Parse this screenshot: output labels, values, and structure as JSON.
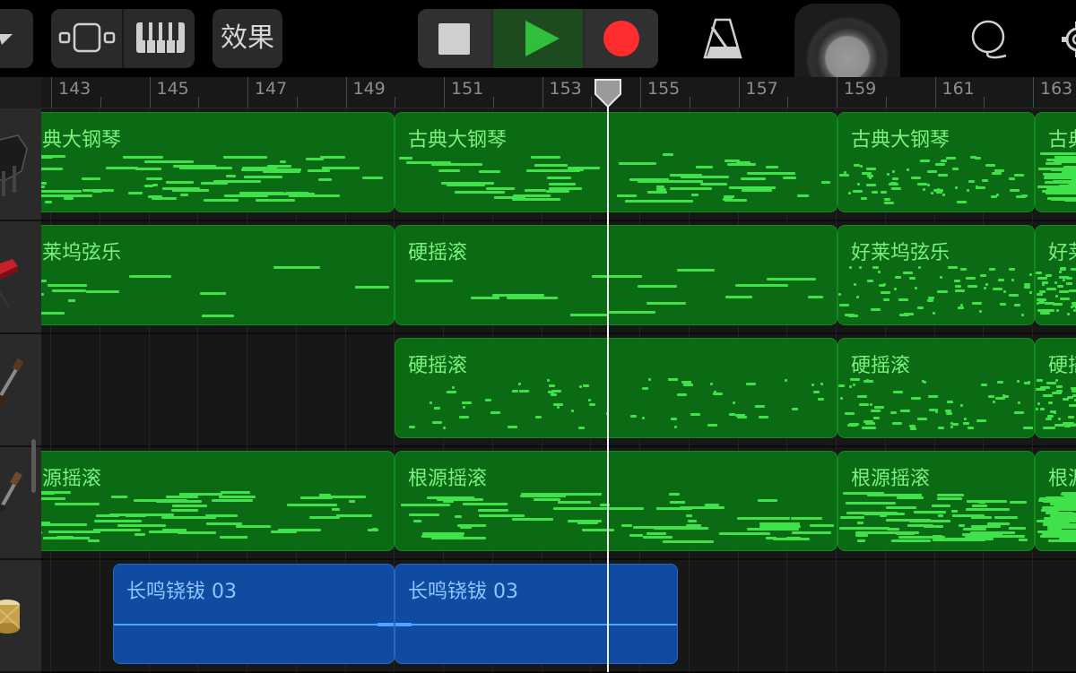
{
  "toolbar": {
    "effects_label": "效果"
  },
  "ruler": {
    "bar_numbers": [
      "143",
      "145",
      "147",
      "149",
      "151",
      "153",
      "155",
      "157",
      "159",
      "161",
      "163"
    ]
  },
  "tracks": [
    {
      "regions": [
        {
          "name": "典大钢琴"
        },
        {
          "name": "古典大钢琴"
        },
        {
          "name": "古典大钢琴"
        },
        {
          "name": "古典"
        }
      ]
    },
    {
      "regions": [
        {
          "name": "莱坞弦乐"
        },
        {
          "name": "硬摇滚"
        },
        {
          "name": "好莱坞弦乐"
        },
        {
          "name": "好莱"
        }
      ]
    },
    {
      "regions": [
        {
          "name": "硬摇滚"
        },
        {
          "name": "硬摇滚"
        },
        {
          "name": "硬摇"
        }
      ]
    },
    {
      "regions": [
        {
          "name": "源摇滚"
        },
        {
          "name": "根源摇滚"
        },
        {
          "name": "根源摇滚"
        },
        {
          "name": "根源"
        }
      ]
    },
    {
      "regions": [
        {
          "name": "长鸣铙钹 03"
        },
        {
          "name": "长鸣铙钹 03"
        }
      ]
    }
  ],
  "colors": {
    "midi_region": "#0a6b14",
    "midi_note": "#3fe24a",
    "audio_region": "#0f4ba0",
    "play_active": "#2fbf3a",
    "record": "#ff2d2d"
  }
}
